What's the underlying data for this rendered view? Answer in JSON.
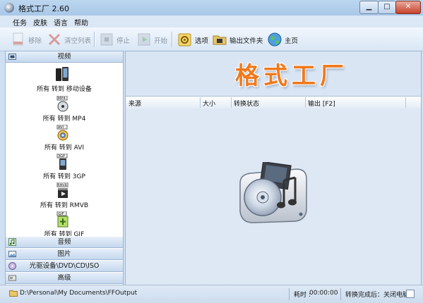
{
  "window": {
    "title": "格式工厂 2.60"
  },
  "menu": [
    "任务",
    "皮肤",
    "语言",
    "帮助"
  ],
  "toolbar": {
    "remove": "移除",
    "clear": "清空列表",
    "stop": "停止",
    "start": "开始",
    "options": "选项",
    "output_folder": "输出文件夹",
    "home": "主页"
  },
  "sidebar": {
    "video": "视频",
    "audio": "音频",
    "image": "图片",
    "rom": "光驱设备\\DVD\\CD\\ISO",
    "advanced": "高级",
    "video_items": [
      {
        "label": "所有 转到 移动设备",
        "icon": "mobile-device-icon"
      },
      {
        "label": "所有 转到 MP4",
        "icon": "mp4-icon"
      },
      {
        "label": "所有 转到 AVI",
        "icon": "avi-icon"
      },
      {
        "label": "所有 转到 3GP",
        "icon": "3gp-icon"
      },
      {
        "label": "所有 转到 RMVB",
        "icon": "rmvb-icon"
      },
      {
        "label": "所有 转到 GIF",
        "icon": "gif-icon"
      }
    ],
    "badges": [
      "MP4",
      "AVI",
      "3GP",
      "RMVB",
      "GIF"
    ]
  },
  "banner": {
    "title": "格式工厂"
  },
  "table": {
    "columns": [
      "来源",
      "大小",
      "转换状态",
      "输出 [F2]"
    ]
  },
  "status": {
    "path": "D:\\Personal\\My Documents\\FFOutput",
    "time_label": "耗时 :",
    "time": "00:00:00",
    "after_label": "转换完成后：关闭电脑"
  },
  "colors": {
    "accent": "#f07a1e",
    "background": "#d9e5f3"
  }
}
